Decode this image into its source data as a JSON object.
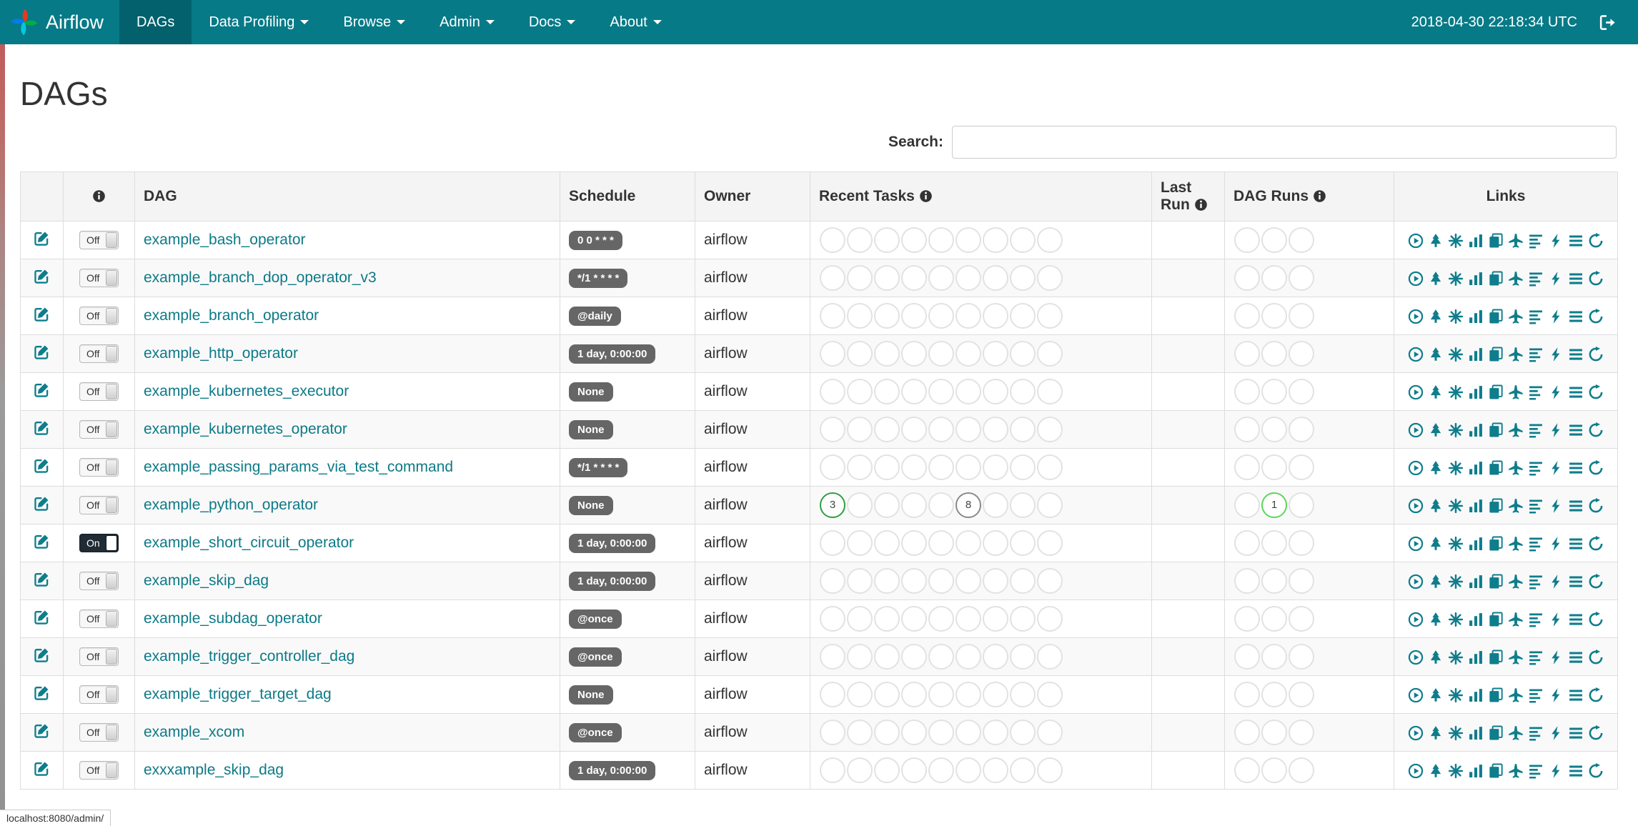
{
  "colors": {
    "navbar_bg": "#077A87",
    "navbar_active_bg": "#02616C",
    "link": "#0C7A87",
    "icon_teal": "#0E7D8C",
    "badge_bg": "#666666",
    "table_border": "#DDDDDD",
    "circle_border": "#E2E2E2",
    "toggle_on_bg": "#202B33",
    "state_success": "#2F9E44",
    "state_running": "#5CD65C",
    "state_none": "#8A8A8A"
  },
  "navbar": {
    "brand": "Airflow",
    "clock": "2018-04-30 22:18:34 UTC",
    "items": [
      {
        "label": "DAGs",
        "active": true,
        "caret": false
      },
      {
        "label": "Data Profiling",
        "active": false,
        "caret": true
      },
      {
        "label": "Browse",
        "active": false,
        "caret": true
      },
      {
        "label": "Admin",
        "active": false,
        "caret": true
      },
      {
        "label": "Docs",
        "active": false,
        "caret": true
      },
      {
        "label": "About",
        "active": false,
        "caret": true
      }
    ]
  },
  "page": {
    "title": "DAGs",
    "search_label": "Search:",
    "status_bar": "localhost:8080/admin/"
  },
  "table": {
    "headers": {
      "dag": "DAG",
      "schedule": "Schedule",
      "owner": "Owner",
      "recent_tasks": "Recent Tasks",
      "last_run_line1": "Last",
      "last_run_line2": "Run",
      "dag_runs": "DAG Runs",
      "links": "Links"
    },
    "toggle_on_label": "On",
    "toggle_off_label": "Off",
    "recent_task_slots": 9,
    "dag_run_slots": 3,
    "links": [
      {
        "name": "trigger-dag-icon",
        "symbol": "play"
      },
      {
        "name": "tree-view-icon",
        "symbol": "tree"
      },
      {
        "name": "graph-view-icon",
        "symbol": "burst"
      },
      {
        "name": "task-duration-icon",
        "symbol": "bars"
      },
      {
        "name": "task-tries-icon",
        "symbol": "copy"
      },
      {
        "name": "landing-times-icon",
        "symbol": "plane"
      },
      {
        "name": "gantt-view-icon",
        "symbol": "align"
      },
      {
        "name": "code-view-icon",
        "symbol": "bolt"
      },
      {
        "name": "logs-icon",
        "symbol": "menu"
      },
      {
        "name": "refresh-icon",
        "symbol": "refresh"
      }
    ],
    "rows": [
      {
        "dag": "example_bash_operator",
        "schedule": "0 0 * * *",
        "owner": "airflow",
        "on": false,
        "recent_tasks": [],
        "dag_runs": []
      },
      {
        "dag": "example_branch_dop_operator_v3",
        "schedule": "*/1 * * * *",
        "owner": "airflow",
        "on": false,
        "recent_tasks": [],
        "dag_runs": []
      },
      {
        "dag": "example_branch_operator",
        "schedule": "@daily",
        "owner": "airflow",
        "on": false,
        "recent_tasks": [],
        "dag_runs": []
      },
      {
        "dag": "example_http_operator",
        "schedule": "1 day, 0:00:00",
        "owner": "airflow",
        "on": false,
        "recent_tasks": [],
        "dag_runs": []
      },
      {
        "dag": "example_kubernetes_executor",
        "schedule": "None",
        "owner": "airflow",
        "on": false,
        "recent_tasks": [],
        "dag_runs": []
      },
      {
        "dag": "example_kubernetes_operator",
        "schedule": "None",
        "owner": "airflow",
        "on": false,
        "recent_tasks": [],
        "dag_runs": []
      },
      {
        "dag": "example_passing_params_via_test_command",
        "schedule": "*/1 * * * *",
        "owner": "airflow",
        "on": false,
        "recent_tasks": [],
        "dag_runs": []
      },
      {
        "dag": "example_python_operator",
        "schedule": "None",
        "owner": "airflow",
        "on": false,
        "recent_tasks": [
          {
            "slot": 0,
            "count": 3,
            "state": "success"
          },
          {
            "slot": 5,
            "count": 8,
            "state": "none"
          }
        ],
        "dag_runs": [
          {
            "slot": 1,
            "count": 1,
            "state": "running"
          }
        ]
      },
      {
        "dag": "example_short_circuit_operator",
        "schedule": "1 day, 0:00:00",
        "owner": "airflow",
        "on": true,
        "recent_tasks": [],
        "dag_runs": []
      },
      {
        "dag": "example_skip_dag",
        "schedule": "1 day, 0:00:00",
        "owner": "airflow",
        "on": false,
        "recent_tasks": [],
        "dag_runs": []
      },
      {
        "dag": "example_subdag_operator",
        "schedule": "@once",
        "owner": "airflow",
        "on": false,
        "recent_tasks": [],
        "dag_runs": []
      },
      {
        "dag": "example_trigger_controller_dag",
        "schedule": "@once",
        "owner": "airflow",
        "on": false,
        "recent_tasks": [],
        "dag_runs": []
      },
      {
        "dag": "example_trigger_target_dag",
        "schedule": "None",
        "owner": "airflow",
        "on": false,
        "recent_tasks": [],
        "dag_runs": []
      },
      {
        "dag": "example_xcom",
        "schedule": "@once",
        "owner": "airflow",
        "on": false,
        "recent_tasks": [],
        "dag_runs": []
      },
      {
        "dag": "exxxample_skip_dag",
        "schedule": "1 day, 0:00:00",
        "owner": "airflow",
        "on": false,
        "recent_tasks": [],
        "dag_runs": []
      }
    ]
  }
}
